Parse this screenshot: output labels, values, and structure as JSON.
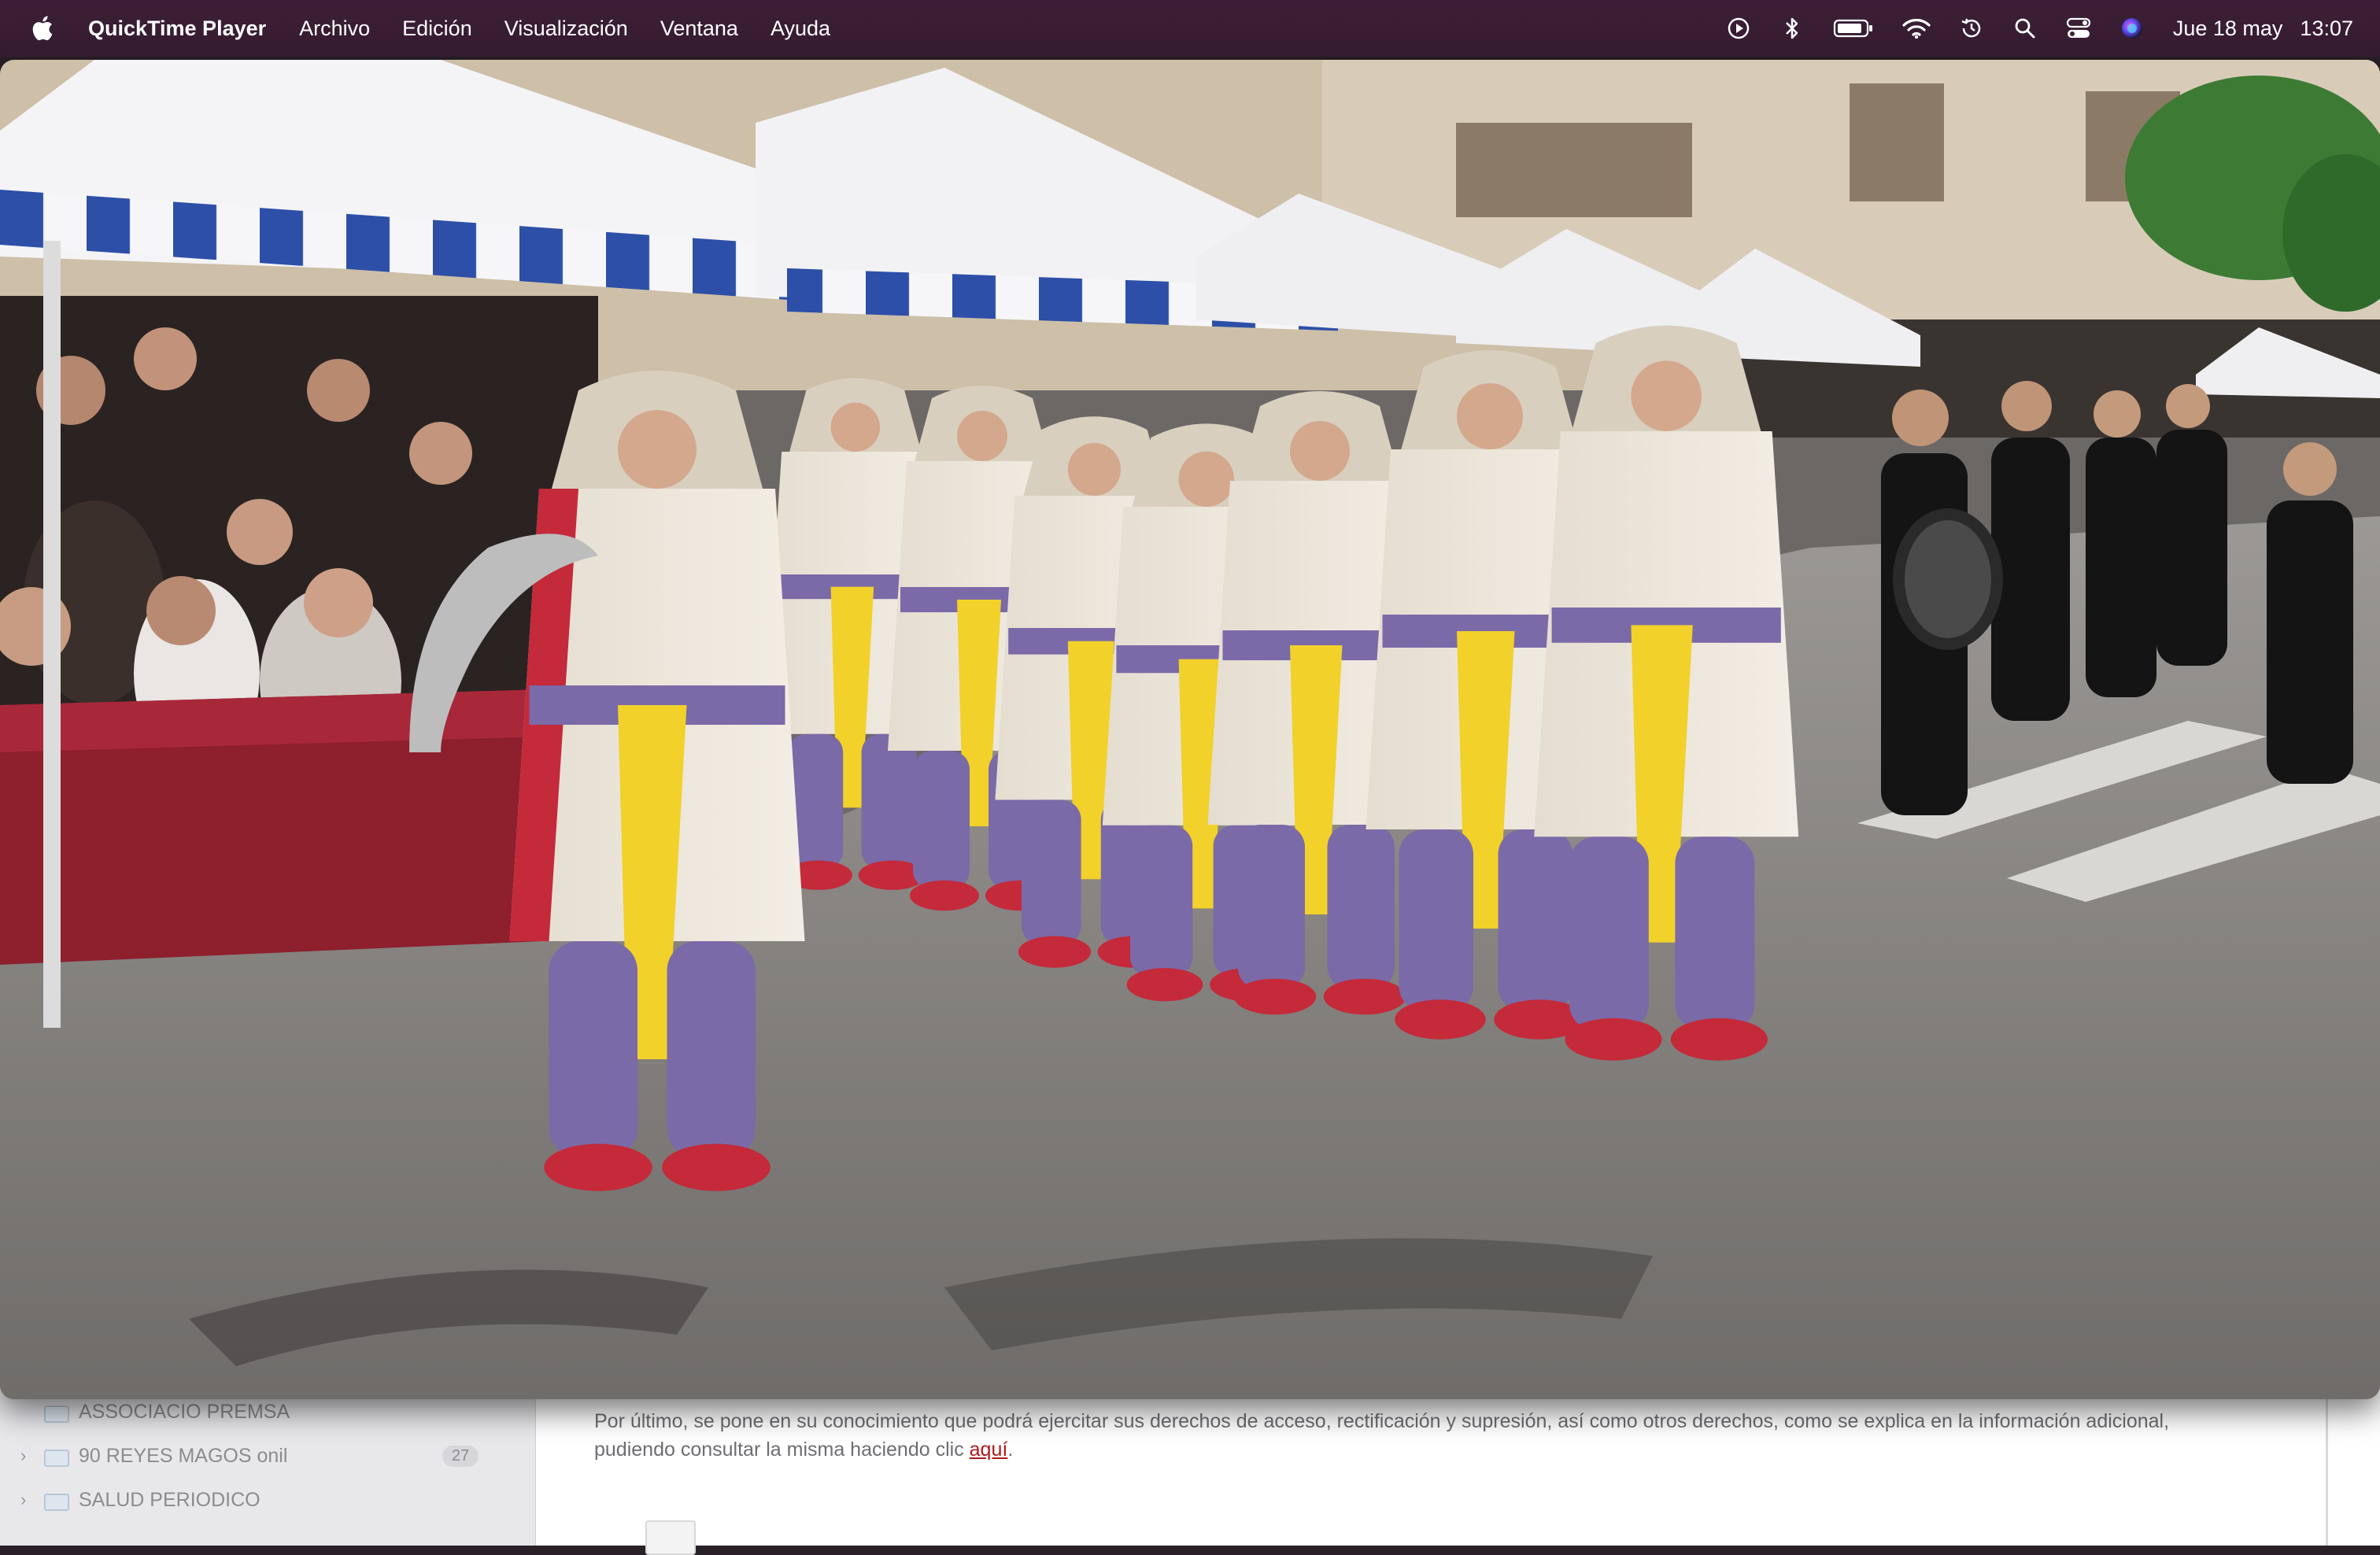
{
  "menubar": {
    "app_name": "QuickTime Player",
    "menus": [
      "Archivo",
      "Edición",
      "Visualización",
      "Ventana",
      "Ayuda"
    ],
    "status_icons": [
      "play-circle-icon",
      "bluetooth-icon",
      "battery-icon",
      "wifi-icon",
      "time-machine-icon",
      "spotlight-icon",
      "control-center-icon",
      "siri-icon"
    ],
    "date": "Jue 18 may",
    "time": "13:07"
  },
  "mail": {
    "folders": [
      {
        "label": "ASSOCIACIO PREMSA",
        "has_chevron": false
      },
      {
        "label": "90 REYES MAGOS onil",
        "has_chevron": true,
        "count": "27"
      },
      {
        "label": "SALUD PERIODICO",
        "has_chevron": true
      }
    ],
    "body_text": "Por último, se pone en su conocimiento que podrá ejercitar sus derechos de acceso, rectificación y supresión, así como otros derechos, como se explica en la información adicional, pudiendo consultar la misma haciendo clic ",
    "link_text": "aquí",
    "body_end": "."
  },
  "video": {
    "content": "parade-video-frame"
  },
  "colors": {
    "menubar": "#3b1f36",
    "link": "#b01818",
    "tent_blue": "#2d4fa8",
    "costume_yellow": "#f2d12a",
    "costume_purple": "#7a6aa8",
    "costume_red": "#c42a3a"
  }
}
